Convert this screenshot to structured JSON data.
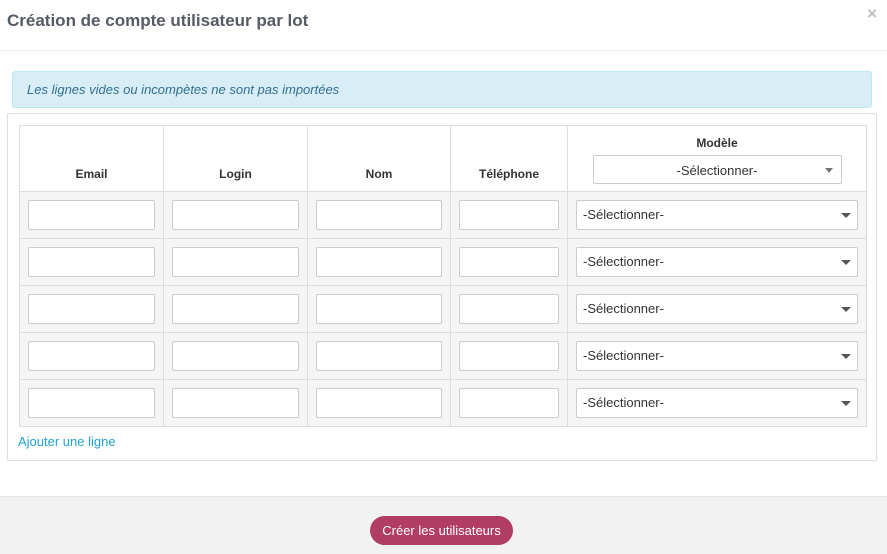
{
  "header": {
    "title": "Création de compte utilisateur par lot",
    "close": "×"
  },
  "alert": {
    "text": "Les lignes vides ou incompètes ne sont pas importées"
  },
  "table": {
    "columns": {
      "email": "Email",
      "login": "Login",
      "nom": "Nom",
      "telephone": "Téléphone",
      "modele": "Modèle"
    },
    "header_select": "-Sélectionner-",
    "rows": [
      {
        "email": "",
        "login": "",
        "nom": "",
        "telephone": "",
        "modele": "-Sélectionner-"
      },
      {
        "email": "",
        "login": "",
        "nom": "",
        "telephone": "",
        "modele": "-Sélectionner-"
      },
      {
        "email": "",
        "login": "",
        "nom": "",
        "telephone": "",
        "modele": "-Sélectionner-"
      },
      {
        "email": "",
        "login": "",
        "nom": "",
        "telephone": "",
        "modele": "-Sélectionner-"
      },
      {
        "email": "",
        "login": "",
        "nom": "",
        "telephone": "",
        "modele": "-Sélectionner-"
      }
    ]
  },
  "add_row": "Ajouter une ligne",
  "footer": {
    "submit": "Créer les utilisateurs"
  },
  "colors": {
    "accent": "#b13d64",
    "link": "#1fa3cf",
    "alert_bg": "#d9edf7",
    "alert_text": "#31708f"
  }
}
